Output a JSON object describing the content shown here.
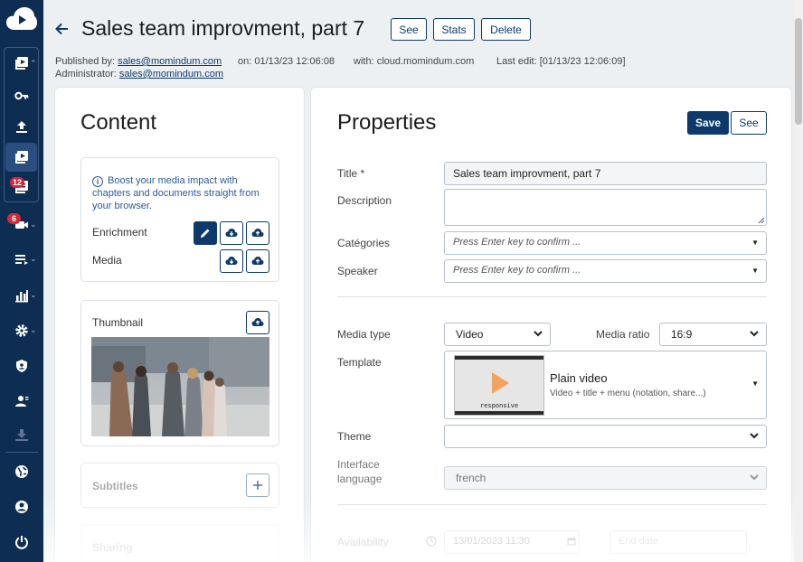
{
  "sidebar": {
    "badges": {
      "notifications": "12",
      "live": "6"
    },
    "items": [
      "upload-icon-group",
      "key-icon",
      "upload-icon",
      "media-icon",
      "media-stack-icon",
      "camera-icon",
      "list-icon",
      "chart-icon",
      "gear-icon",
      "shield-icon",
      "users-icon",
      "download-icon",
      "globe-icon",
      "account-icon",
      "power-icon"
    ]
  },
  "header": {
    "title": "Sales team improvment, part 7",
    "buttons": {
      "see": "See",
      "stats": "Stats",
      "delete": "Delete"
    },
    "meta": {
      "published_label": "Published by:",
      "published_by": "sales@momindum.com",
      "on_label": "on:",
      "on_value": "01/13/23  12:06:08",
      "with_label": "with:",
      "with_value": "cloud.momindum.com",
      "last_edit_label": "Last edit:",
      "last_edit_value": "[01/13/23  12:06:09]",
      "admin_label": "Administrator:",
      "admin_value": "sales@momindum.com"
    }
  },
  "content": {
    "title": "Content",
    "info": "Boost your media impact with chapters and documents straight from your browser.",
    "enrichment_label": "Enrichment",
    "media_label": "Media",
    "thumbnail_label": "Thumbnail",
    "subtitles_label": "Subtitles",
    "sharing_label": "Sharing"
  },
  "properties": {
    "title": "Properties",
    "save": "Save",
    "see": "See",
    "labels": {
      "title": "Title *",
      "description": "Description",
      "categories": "Catégories",
      "speaker": "Speaker",
      "media_type": "Media type",
      "media_ratio": "Media ratio",
      "template": "Template",
      "theme": "Theme",
      "interface_language_1": "Interface",
      "interface_language_2": "language",
      "availability": "Availability"
    },
    "values": {
      "title": "Sales team improvment, part 7",
      "description": "",
      "categories_placeholder": "Press Enter key to confirm ...",
      "speaker_placeholder": "Press Enter key to confirm ...",
      "media_type": "Video",
      "media_ratio": "16:9",
      "template_name": "Plain video",
      "template_desc": "Video + title + menu (notation, share...)",
      "template_thumb_label": "responsive",
      "theme": "",
      "interface_language": "french",
      "availability_start": "13/01/2023 11:30",
      "availability_end_placeholder": "End date"
    }
  }
}
